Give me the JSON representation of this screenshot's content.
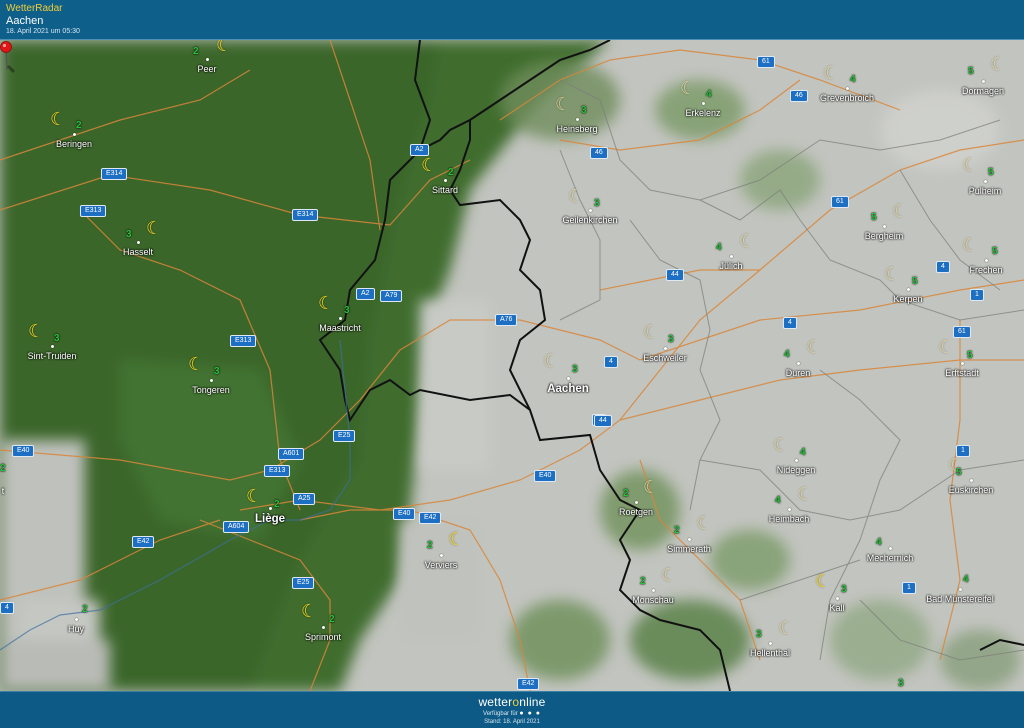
{
  "header": {
    "app_name": "WetterRadar",
    "location": "Aachen",
    "timestamp": "18. April 2021 um 05:30"
  },
  "footer": {
    "brand_prefix": "wetter",
    "brand_o": "o",
    "brand_suffix": "nline",
    "availability": "Verfügbar für",
    "availability_dots": "● ● ●",
    "stand": "Stand: 18. April 2021"
  },
  "colors": {
    "header_bg": "#0f5f8b",
    "accent_yellow": "#f2cd36",
    "forest_green": "#3f6d2e",
    "cloud_grey": "#c4c6c1",
    "road_orange": "#d9863a",
    "road_shield_blue": "#1d6fc4",
    "pin_red": "#e01515",
    "number_green": "#26c23a"
  },
  "cities": [
    {
      "name": "Peer",
      "value": "2"
    },
    {
      "name": "Beringen",
      "value": "2"
    },
    {
      "name": "Hasselt",
      "value": "3"
    },
    {
      "name": "Sint-Truiden",
      "value": "3"
    },
    {
      "name": "Tongeren",
      "value": "3"
    },
    {
      "name": "Sittard",
      "value": "2"
    },
    {
      "name": "Maastricht",
      "value": "3"
    },
    {
      "name": "Liège",
      "value": "2"
    },
    {
      "name": "Huy",
      "value": "2"
    },
    {
      "name": "Sprimont",
      "value": "2"
    },
    {
      "name": "Verviers",
      "value": "2"
    },
    {
      "name": "Heinsberg",
      "value": "3"
    },
    {
      "name": "Geilenkirchen",
      "value": "3"
    },
    {
      "name": "Erkelenz",
      "value": "4"
    },
    {
      "name": "Grevenbroich",
      "value": "4"
    },
    {
      "name": "Dormagen",
      "value": "5"
    },
    {
      "name": "Pulheim",
      "value": "5"
    },
    {
      "name": "Jülich",
      "value": "4"
    },
    {
      "name": "Bergheim",
      "value": "5"
    },
    {
      "name": "Frechen",
      "value": "5"
    },
    {
      "name": "Kerpen",
      "value": "5"
    },
    {
      "name": "Aachen",
      "value": "3"
    },
    {
      "name": "Eschweiler",
      "value": "3"
    },
    {
      "name": "Duren",
      "value": "4"
    },
    {
      "name": "Erftstadt",
      "value": "5"
    },
    {
      "name": "Roetgen",
      "value": "2"
    },
    {
      "name": "Nideggen",
      "value": "4"
    },
    {
      "name": "Heimbach",
      "value": "4"
    },
    {
      "name": "Euskirchen",
      "value": "5"
    },
    {
      "name": "Simmerath",
      "value": "2"
    },
    {
      "name": "Monschau",
      "value": "2"
    },
    {
      "name": "Mechernich",
      "value": "4"
    },
    {
      "name": "Kall",
      "value": "3"
    },
    {
      "name": "Bad Münstereifel",
      "value": "4"
    },
    {
      "name": "Hellenthal",
      "value": "3"
    }
  ],
  "edge_values": {
    "left_partial_value": "2",
    "left_partial_label": "t",
    "bottom_value": "3"
  },
  "roads": [
    "E314",
    "E313",
    "E314",
    "A2",
    "A2",
    "A79",
    "A76",
    "E313",
    "E25",
    "A601",
    "E40",
    "E313",
    "A25",
    "A604",
    "E42",
    "E40",
    "E42",
    "E40",
    "E25",
    "E42",
    "46",
    "44",
    "61",
    "46",
    "4",
    "4",
    "1",
    "61",
    "1",
    "1",
    "4",
    "44",
    "61",
    "4",
    "4"
  ],
  "weather_icon": "moon-crescent-icon",
  "marker_icon": "location-pin-icon"
}
